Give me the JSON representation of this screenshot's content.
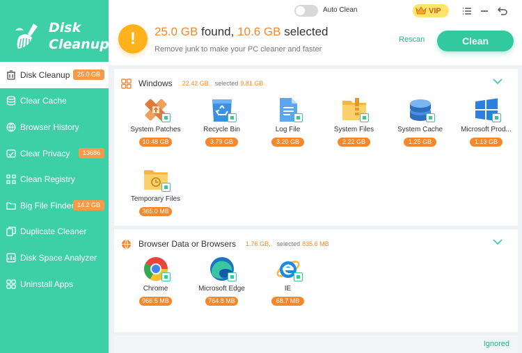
{
  "app": {
    "logo_line1": "Disk",
    "logo_line2": "Cleanup"
  },
  "sidebar": {
    "items": [
      {
        "label": "Disk Cleanup",
        "badge": "25.0 GB",
        "icon": "disk-cleanup-icon",
        "active": true
      },
      {
        "label": "Clear Cache",
        "badge": "",
        "icon": "cache-icon"
      },
      {
        "label": "Browser History",
        "badge": "",
        "icon": "browser-icon"
      },
      {
        "label": "Clear Privacy",
        "badge": "13686",
        "icon": "privacy-icon"
      },
      {
        "label": "Clean Registry",
        "badge": "",
        "icon": "registry-icon"
      },
      {
        "label": "Big File Finder",
        "badge": "14.2 GB",
        "icon": "folder-icon"
      },
      {
        "label": "Duplicate Cleaner",
        "badge": "",
        "icon": "duplicate-icon"
      },
      {
        "label": "Disk Space Analyzer",
        "badge": "",
        "icon": "analyzer-icon"
      },
      {
        "label": "Uninstall Apps",
        "badge": "",
        "icon": "apps-icon"
      }
    ]
  },
  "header": {
    "auto_clean_label": "Auto Clean",
    "auto_clean_on": false,
    "vip_label": "VIP",
    "found_value": "25.0 GB",
    "found_label": " found, ",
    "selected_value": "10.6 GB",
    "selected_label": " selected",
    "subtitle": "Remove junk to make your PC cleaner and faster",
    "rescan_label": "Rescan",
    "clean_label": "Clean"
  },
  "categories": [
    {
      "title": "Windows",
      "size": "22.42 GB",
      "selected_label": "selected",
      "selected_value": "9.81 GB",
      "items": [
        {
          "label": "System Patches",
          "size": "10.48 GB",
          "icon": "system-patches-icon"
        },
        {
          "label": "Recycle Bin",
          "size": "3.79 GB",
          "icon": "recycle-bin-icon"
        },
        {
          "label": "Log File",
          "size": "3.20 GB",
          "icon": "log-file-icon"
        },
        {
          "label": "System Files",
          "size": "2.22 GB",
          "icon": "system-files-icon"
        },
        {
          "label": "System Cache",
          "size": "1.25 GB",
          "icon": "system-cache-icon"
        },
        {
          "label": "Microsoft Prod...",
          "size": "1.13 GB",
          "icon": "windows-logo-icon"
        },
        {
          "label": "Temporary Files",
          "size": "365.0 MB",
          "icon": "temporary-files-icon"
        }
      ]
    },
    {
      "title": "Browser Data or Browsers",
      "size": "1.76 GB,",
      "selected_label": "selected",
      "selected_value": "835.6 MB",
      "items": [
        {
          "label": "Chrome",
          "size": "966.5 MB",
          "icon": "chrome-icon"
        },
        {
          "label": "Microsoft Edge",
          "size": "764.8 MB",
          "icon": "edge-icon"
        },
        {
          "label": "IE",
          "size": "68.7 MB",
          "icon": "ie-icon"
        }
      ]
    }
  ],
  "footer": {
    "ignored_label": "Ignored"
  },
  "colors": {
    "sidebar": "#3dcfa6",
    "accent": "#33c99e",
    "orange": "#f5872c",
    "warning": "#ffb21c"
  }
}
